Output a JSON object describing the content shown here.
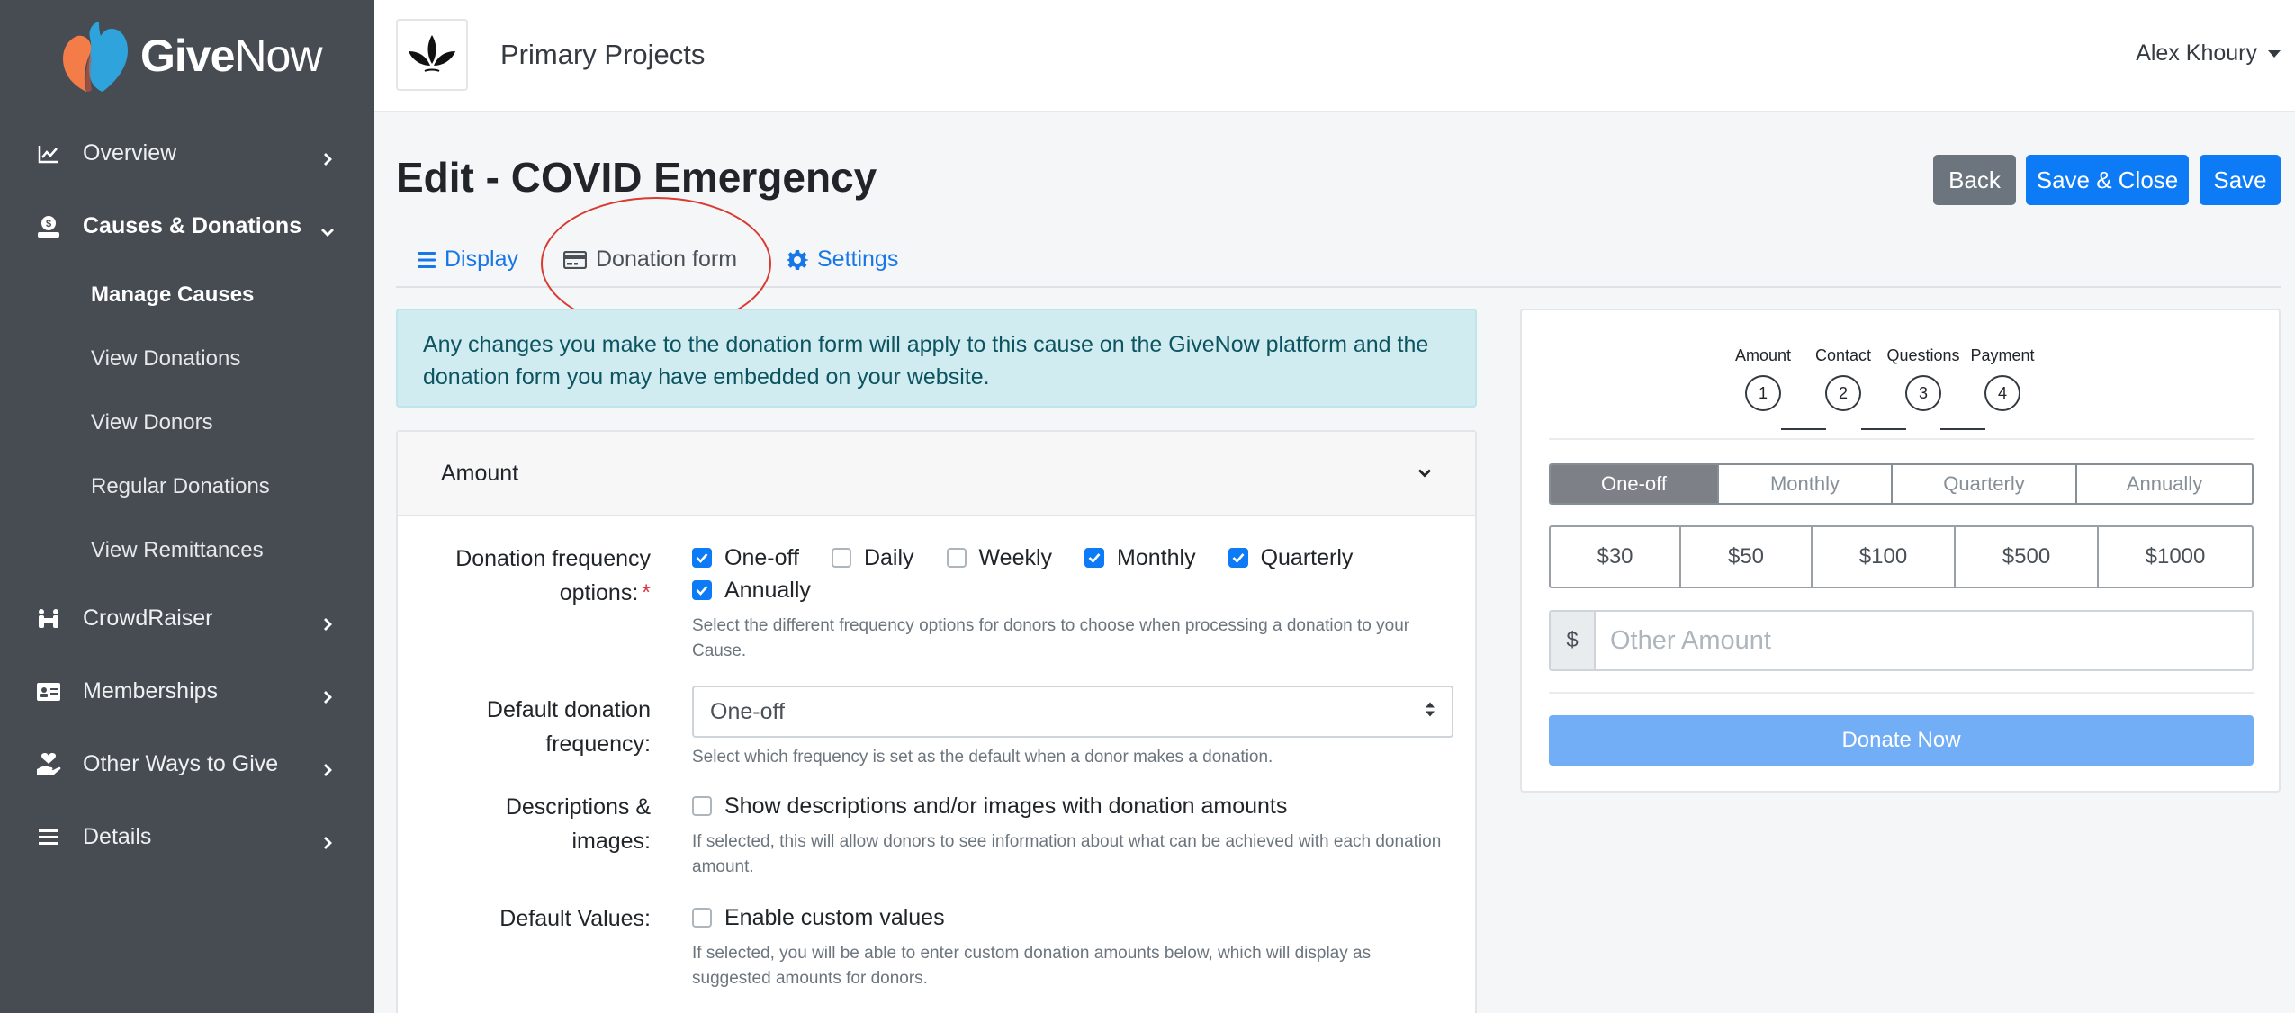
{
  "app": {
    "logo_give": "Give",
    "logo_now": "Now",
    "logo_colors": {
      "orange": "#f47c48",
      "blue": "#2ea3dc"
    }
  },
  "sidebar": {
    "items": [
      {
        "label": "Overview",
        "icon": "chart-line-icon",
        "expanded": false
      },
      {
        "label": "Causes & Donations",
        "icon": "donate-icon",
        "expanded": true,
        "children": [
          {
            "label": "Manage Causes",
            "active": true
          },
          {
            "label": "View Donations"
          },
          {
            "label": "View Donors"
          },
          {
            "label": "Regular Donations"
          },
          {
            "label": "View Remittances"
          }
        ]
      },
      {
        "label": "CrowdRaiser",
        "icon": "people-carry-icon",
        "expanded": false
      },
      {
        "label": "Memberships",
        "icon": "id-card-icon",
        "expanded": false
      },
      {
        "label": "Other Ways to Give",
        "icon": "hand-holding-heart-icon",
        "expanded": false
      },
      {
        "label": "Details",
        "icon": "list-icon",
        "expanded": false
      }
    ]
  },
  "header": {
    "org_title": "Primary Projects",
    "user_name": "Alex Khoury"
  },
  "page": {
    "title": "Edit - COVID Emergency",
    "buttons": {
      "back": "Back",
      "save_close": "Save & Close",
      "save": "Save"
    },
    "tabs": [
      {
        "label": "Display",
        "icon": "bars-icon"
      },
      {
        "label": "Donation form",
        "icon": "credit-card-icon",
        "active": true
      },
      {
        "label": "Settings",
        "icon": "gear-icon"
      }
    ],
    "alert": "Any changes you make to the donation form will apply to this cause on the GiveNow platform and the donation form you may have embedded on your website."
  },
  "form": {
    "section_title": "Amount",
    "frequency": {
      "label_line1": "Donation frequency",
      "label_line2": "options:",
      "required_mark": "*",
      "options": [
        {
          "label": "One-off",
          "checked": true
        },
        {
          "label": "Daily",
          "checked": false
        },
        {
          "label": "Weekly",
          "checked": false
        },
        {
          "label": "Monthly",
          "checked": true
        },
        {
          "label": "Quarterly",
          "checked": true
        },
        {
          "label": "Annually",
          "checked": true
        }
      ],
      "help": "Select the different frequency options for donors to choose when processing a donation to your Cause."
    },
    "default_frequency": {
      "label_line1": "Default donation",
      "label_line2": "frequency:",
      "value": "One-off",
      "help": "Select which frequency is set as the default when a donor makes a donation."
    },
    "descriptions": {
      "label_line1": "Descriptions &",
      "label_line2": "images:",
      "checkbox_label": "Show descriptions and/or images with donation amounts",
      "checked": false,
      "help": "If selected, this will allow donors to see information about what can be achieved with each donation amount."
    },
    "default_values": {
      "label": "Default Values:",
      "checkbox_label": "Enable custom values",
      "checked": false,
      "help": "If selected, you will be able to enter custom donation amounts below, which will display as suggested amounts for donors."
    }
  },
  "preview": {
    "steps": [
      {
        "label": "Amount",
        "number": "1"
      },
      {
        "label": "Contact",
        "number": "2"
      },
      {
        "label": "Questions",
        "number": "3"
      },
      {
        "label": "Payment",
        "number": "4"
      }
    ],
    "frequencies": [
      {
        "label": "One-off",
        "selected": true
      },
      {
        "label": "Monthly",
        "selected": false
      },
      {
        "label": "Quarterly",
        "selected": false
      },
      {
        "label": "Annually",
        "selected": false
      }
    ],
    "amounts": [
      "$30",
      "$50",
      "$100",
      "$500",
      "$1000"
    ],
    "currency_symbol": "$",
    "other_placeholder": "Other Amount",
    "donate_label": "Donate Now"
  }
}
